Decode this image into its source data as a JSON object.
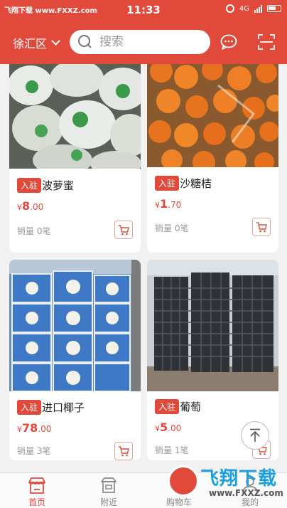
{
  "status_bar": {
    "watermark": "飞翔下载 www.FXXZ.com",
    "time": "11:33",
    "network": "4G"
  },
  "header": {
    "district": "徐汇区",
    "search_placeholder": "搜索",
    "message_icon": "chat-bubble-icon",
    "scan_icon": "scan-icon"
  },
  "products": [
    {
      "tag": "入驻",
      "name": "波萝蜜",
      "price_currency": "¥",
      "price_int": "8",
      "price_dec": ".00",
      "sales": "销量 0笔",
      "image": "jackfruit-photo"
    },
    {
      "tag": "入驻",
      "name": "沙糖桔",
      "price_currency": "¥",
      "price_int": "1",
      "price_dec": ".70",
      "sales": "销量 0笔",
      "image": "tangerine-photo"
    },
    {
      "tag": "入驻",
      "name": "进口椰子",
      "price_currency": "¥",
      "price_int": "78",
      "price_dec": ".00",
      "sales": "销量 3笔",
      "image": "coconut-boxes-photo"
    },
    {
      "tag": "入驻",
      "name": "葡萄",
      "price_currency": "¥",
      "price_int": "5",
      "price_dec": ".00",
      "sales": "销量 1笔",
      "image": "grape-crates-photo"
    }
  ],
  "bottom_nav": [
    {
      "label": "首页",
      "icon": "shop-icon",
      "active": true
    },
    {
      "label": "附近",
      "icon": "nearby-icon",
      "active": false
    },
    {
      "label": "购物车",
      "icon": "cart-icon",
      "active": false
    },
    {
      "label": "我的",
      "icon": "user-icon",
      "active": false
    }
  ],
  "watermark_logo": {
    "cn": "飞翔下载",
    "en": "www.FXXZ.com"
  },
  "colors": {
    "accent": "#e14a3b",
    "background": "#f1f1f1"
  }
}
